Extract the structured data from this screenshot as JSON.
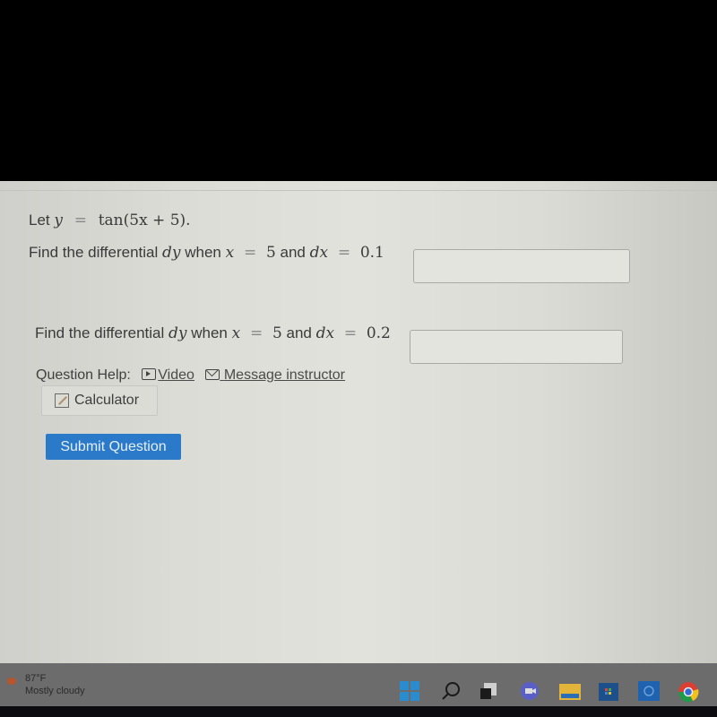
{
  "question": {
    "intro_prefix": "Let",
    "intro_var": "y",
    "intro_equals": "=",
    "intro_expr": "tan(5x + 5).",
    "parts": [
      {
        "prefix": "Find the differential",
        "dy": "dy",
        "when": "when",
        "xvar": "x",
        "eq1": "=",
        "xval": "5",
        "and": "and",
        "dx": "dx",
        "eq2": "=",
        "dxval": "0.1",
        "answer_value": ""
      },
      {
        "prefix": "Find the differential",
        "dy": "dy",
        "when": "when",
        "xvar": "x",
        "eq1": "=",
        "xval": "5",
        "and": "and",
        "dx": "dx",
        "eq2": "=",
        "dxval": "0.2",
        "answer_value": ""
      }
    ]
  },
  "help": {
    "label": "Question Help:",
    "video": "Video",
    "message": "Message instructor",
    "calculator": "Calculator"
  },
  "submit_label": "Submit Question",
  "taskbar": {
    "weather_temp": "87°F",
    "weather_desc": "Mostly cloudy",
    "icons": [
      "windows-start-icon",
      "search-icon",
      "task-view-icon",
      "chat-icon",
      "file-explorer-icon",
      "store-icon",
      "app-icon",
      "chrome-icon"
    ]
  },
  "colors": {
    "submit": "#2a7ac9"
  }
}
